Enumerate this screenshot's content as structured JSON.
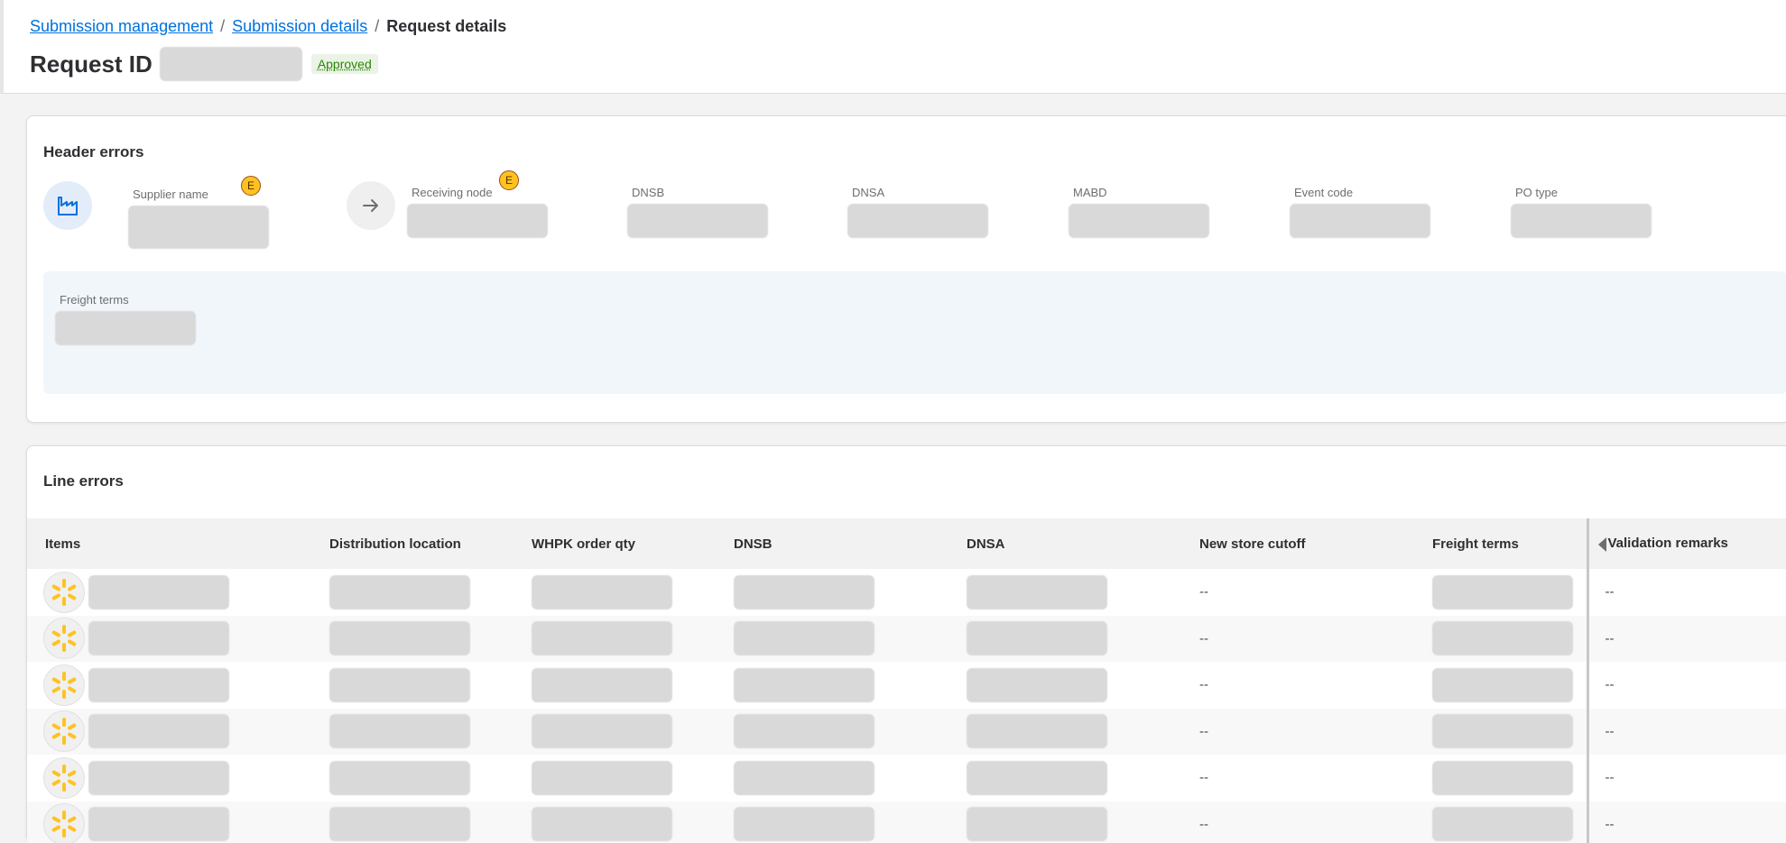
{
  "breadcrumb": {
    "submission_management": "Submission management",
    "submission_details": "Submission details",
    "separator": "/",
    "current": "Request details"
  },
  "page": {
    "title": "Request ID",
    "status": "Approved"
  },
  "header_errors": {
    "title": "Header errors",
    "fields": {
      "supplier_name": "Supplier name",
      "receiving_node": "Receiving node",
      "dnsb": "DNSB",
      "dnsa": "DNSA",
      "mabd": "MABD",
      "event_code": "Event code",
      "po_type": "PO type",
      "freight_terms": "Freight terms"
    },
    "error_badge": "E"
  },
  "line_errors": {
    "title": "Line errors",
    "columns": {
      "items": "Items",
      "distribution_location": "Distribution location",
      "whpk_order_qty": "WHPK order qty",
      "dnsb": "DNSB",
      "dnsa": "DNSA",
      "new_store_cutoff": "New store cutoff",
      "freight_terms": "Freight terms",
      "validation_remarks": "Validation remarks"
    },
    "rows": [
      {
        "new_store_cutoff": "--",
        "validation_remarks": "--"
      },
      {
        "new_store_cutoff": "--",
        "validation_remarks": "--"
      },
      {
        "new_store_cutoff": "--",
        "validation_remarks": "--"
      },
      {
        "new_store_cutoff": "--",
        "validation_remarks": "--"
      },
      {
        "new_store_cutoff": "--",
        "validation_remarks": "--"
      },
      {
        "new_store_cutoff": "--",
        "validation_remarks": "--"
      }
    ]
  },
  "icons": {
    "factory": "factory-icon",
    "arrow": "arrow-right-icon",
    "spark": "walmart-spark-icon",
    "caret": "caret-left-icon"
  },
  "colors": {
    "link": "#0071dc",
    "status_bg": "#eaf3e6",
    "status_text": "#2a8703",
    "error_badge": "#ffc220",
    "spark": "#ffc220",
    "freight_panel_bg": "#f1f6fb"
  }
}
